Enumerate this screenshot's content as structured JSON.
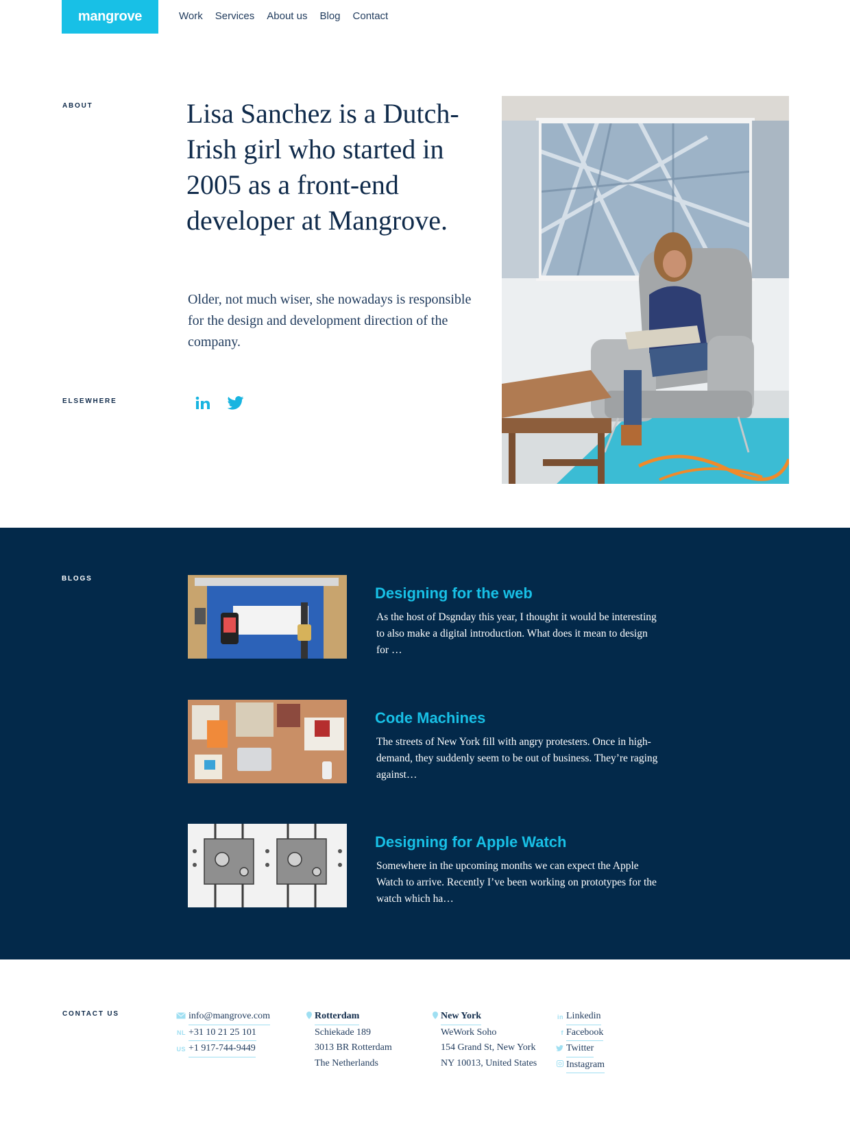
{
  "header": {
    "logo": "mangrove",
    "nav": [
      "Work",
      "Services",
      "About us",
      "Blog",
      "Contact"
    ]
  },
  "about": {
    "label": "ABOUT",
    "headline": "Lisa Sanchez is a Dutch-Irish girl who started in 2005 as a front-end developer at Mangrove.",
    "lede": "Older, not much wiser, she nowadays is responsible for the design and development direction of the company.",
    "elsewhere_label": "ELSEWHERE",
    "social": [
      "linkedin-icon",
      "twitter-icon"
    ]
  },
  "blogs": {
    "label": "BLOGS",
    "posts": [
      {
        "title": "Designing for the web",
        "excerpt": "As the host of Dsgnday this year, I thought it would be interesting to also make a digital introduction. What does it mean to design for …"
      },
      {
        "title": "Code Machines",
        "excerpt": "The streets of New York fill with angry protesters. Once in high-demand, they suddenly seem to be out of business. They’re raging against…"
      },
      {
        "title": "Designing for Apple Watch",
        "excerpt": "Somewhere in the upcoming months we can expect the Apple Watch to arrive. Recently I’ve been working on prototypes for the watch which ha…"
      }
    ]
  },
  "footer": {
    "label": "CONTACT US",
    "contact": {
      "email": "info@mangrove.com",
      "nl_prefix": "NL",
      "nl_phone": "+31 10 21 25 101",
      "us_prefix": "US",
      "us_phone": "+1 917-744-9449"
    },
    "rotterdam": {
      "city": "Rotterdam",
      "lines": [
        "Schiekade 189",
        "3013 BR Rotterdam",
        "The Netherlands"
      ]
    },
    "newyork": {
      "city": "New York",
      "lines": [
        "WeWork Soho",
        "154 Grand St, New York",
        "NY 10013, United States"
      ]
    },
    "social_links": [
      "Linkedin",
      "Facebook",
      "Twitter",
      "Instagram"
    ]
  },
  "colors": {
    "accent": "#18c0e6",
    "navy": "#03294a",
    "text": "#0f2a4a"
  }
}
